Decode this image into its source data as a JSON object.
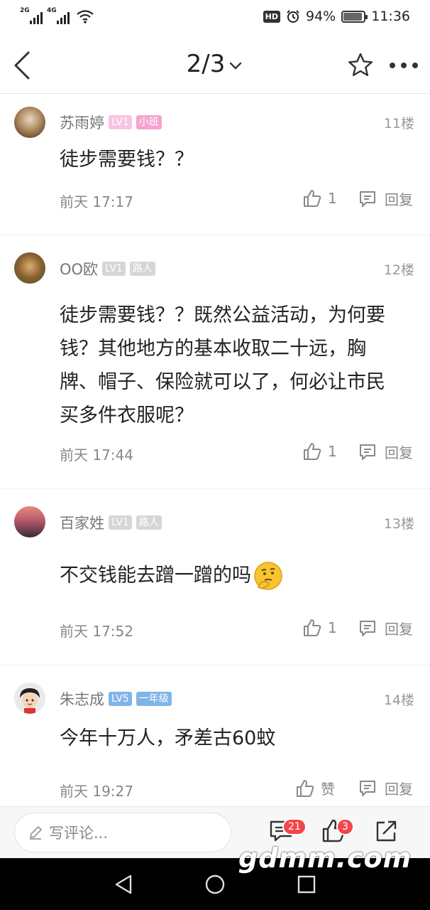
{
  "status_bar": {
    "sim1_label": "2G",
    "sim2_label": "4G",
    "hd_label": "HD",
    "battery_text": "94%",
    "battery_level": 0.94,
    "time": "11:36"
  },
  "nav": {
    "title": "2/3"
  },
  "comments": [
    {
      "name": "苏雨婷",
      "level": "LV1",
      "rank": "小班",
      "floor": "11楼",
      "text": "徒步需要钱？？",
      "time": "前天 17:17",
      "likes": "1",
      "reply_label": "回复",
      "badge_color": "#f5a3d0"
    },
    {
      "name": "OO欧",
      "level": "LV1",
      "rank": "路人",
      "floor": "12楼",
      "text": "徒步需要钱？？既然公益活动，为何要钱？其他地方的基本收取二十远，胸牌、帽子、保险就可以了，何必让市民买多件衣服呢？",
      "time": "前天 17:44",
      "likes": "1",
      "reply_label": "回复",
      "badge_color": "#d6d6d6"
    },
    {
      "name": "百家姓",
      "level": "LV1",
      "rank": "路人",
      "floor": "13楼",
      "text": "不交钱能去蹭一蹭的吗",
      "time": "前天 17:52",
      "likes": "1",
      "reply_label": "回复",
      "badge_color": "#d6d6d6"
    },
    {
      "name": "朱志成",
      "level": "LV5",
      "rank": "一年级",
      "floor": "14楼",
      "text": "今年十万人，矛差古60蚊",
      "time": "前天 19:27",
      "likes": "赞",
      "reply_label": "回复",
      "badge_color": "#7fb4e8"
    }
  ],
  "bottom_bar": {
    "comment_placeholder": "写评论...",
    "comment_count": "21",
    "like_count": "3"
  },
  "watermark": "gdmm.com",
  "colors": {
    "badge_red": "#f2464a",
    "text_secondary": "#888888"
  }
}
